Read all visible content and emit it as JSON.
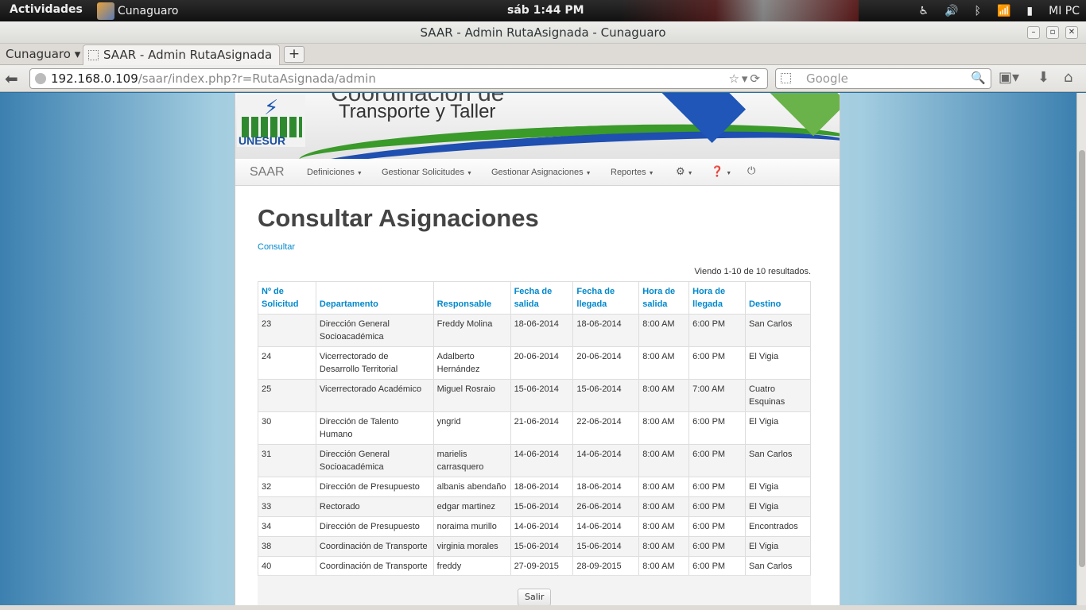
{
  "system_bar": {
    "activities": "Actividades",
    "app_name": "Cunaguaro",
    "clock": "sáb  1:44 PM",
    "user": "MI PC"
  },
  "window": {
    "title": "SAAR - Admin RutaAsignada - Cunaguaro"
  },
  "browser": {
    "tab_group": "Cunaguaro",
    "active_tab": "SAAR - Admin RutaAsignada",
    "new_tab": "+",
    "url_host": "192.168.0.109",
    "url_path": "/saar/index.php?r=RutaAsignada/admin",
    "search_placeholder": "Google"
  },
  "site": {
    "banner_line1": "Coordinación de",
    "banner_line2": "Transporte y Taller",
    "logo_text": "UNESUR",
    "brand": "SAAR",
    "menu": [
      "Definiciones",
      "Gestionar Solicitudes",
      "Gestionar Asignaciones",
      "Reportes"
    ],
    "menu_icons": [
      "gear-icon",
      "help-icon",
      "power-icon"
    ]
  },
  "main": {
    "title": "Consultar Asignaciones",
    "breadcrumb": "Consultar",
    "summary": "Viendo 1-10 de 10 resultados.",
    "headers": [
      "Nº de Solicitud",
      "Departamento",
      "Responsable",
      "Fecha de salida",
      "Fecha de llegada",
      "Hora de salida",
      "Hora de llegada",
      "Destino"
    ],
    "rows": [
      [
        "23",
        "Dirección General Socioacadémica",
        "Freddy Molina",
        "18-06-2014",
        "18-06-2014",
        "8:00 AM",
        "6:00 PM",
        "San Carlos"
      ],
      [
        "24",
        "Vicerrectorado de Desarrollo Territorial",
        "Adalberto Hernández",
        "20-06-2014",
        "20-06-2014",
        "8:00 AM",
        "6:00 PM",
        "El Vigia"
      ],
      [
        "25",
        "Vicerrectorado Académico",
        "Miguel Rosraio",
        "15-06-2014",
        "15-06-2014",
        "8:00 AM",
        "7:00 AM",
        "Cuatro Esquinas"
      ],
      [
        "30",
        "Dirección de Talento Humano",
        "yngrid",
        "21-06-2014",
        "22-06-2014",
        "8:00 AM",
        "6:00 PM",
        "El Vigia"
      ],
      [
        "31",
        "Dirección General Socioacadémica",
        "marielis carrasquero",
        "14-06-2014",
        "14-06-2014",
        "8:00 AM",
        "6:00 PM",
        "San Carlos"
      ],
      [
        "32",
        "Dirección de Presupuesto",
        "albanis abendaño",
        "18-06-2014",
        "18-06-2014",
        "8:00 AM",
        "6:00 PM",
        "El Vigia"
      ],
      [
        "33",
        "Rectorado",
        "edgar martinez",
        "15-06-2014",
        "26-06-2014",
        "8:00 AM",
        "6:00 PM",
        "El Vigia"
      ],
      [
        "34",
        "Dirección de Presupuesto",
        "noraima murillo",
        "14-06-2014",
        "14-06-2014",
        "8:00 AM",
        "6:00 PM",
        "Encontrados"
      ],
      [
        "38",
        "Coordinación de Transporte",
        "virginia morales",
        "15-06-2014",
        "15-06-2014",
        "8:00 AM",
        "6:00 PM",
        "El Vigia"
      ],
      [
        "40",
        "Coordinación de Transporte",
        "freddy",
        "27-09-2015",
        "28-09-2015",
        "8:00 AM",
        "6:00 PM",
        "San Carlos"
      ]
    ],
    "exit_button": "Salir"
  }
}
